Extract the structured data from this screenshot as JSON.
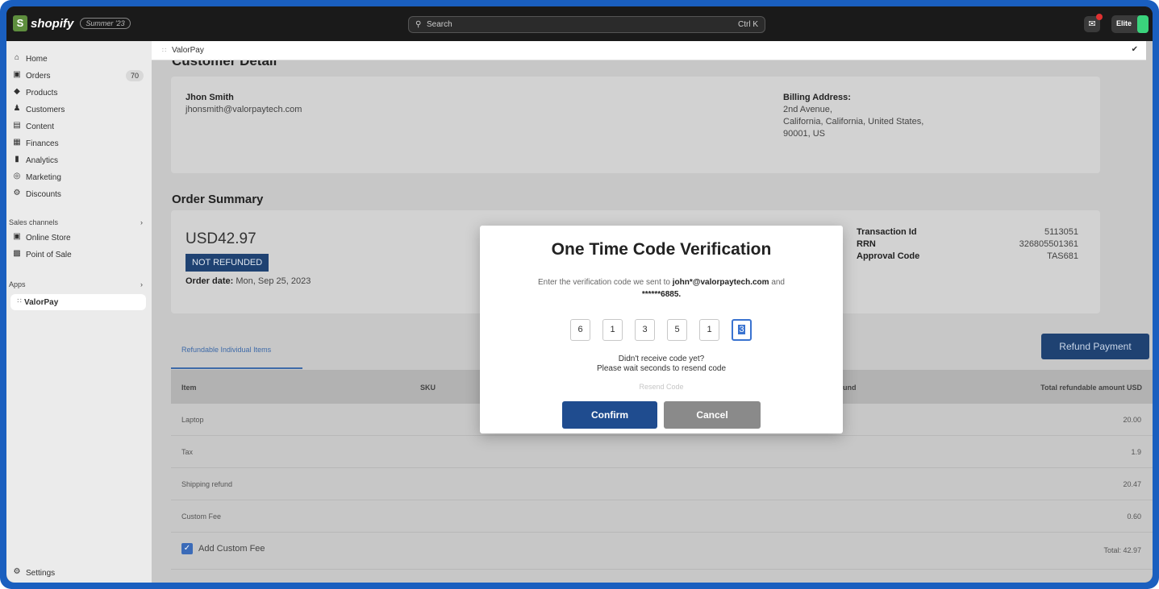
{
  "topbar": {
    "logo_glyph": "S",
    "brand": "shopify",
    "edition": "Summer '23",
    "search_placeholder": "Search",
    "search_shortcut": "Ctrl K",
    "store_name": "Elite"
  },
  "sidebar": {
    "items": [
      {
        "label": "Home",
        "icon": "home-icon"
      },
      {
        "label": "Orders",
        "icon": "orders-icon",
        "badge": "70"
      },
      {
        "label": "Products",
        "icon": "tag-icon"
      },
      {
        "label": "Customers",
        "icon": "person-icon"
      },
      {
        "label": "Content",
        "icon": "content-icon"
      },
      {
        "label": "Finances",
        "icon": "bank-icon"
      },
      {
        "label": "Analytics",
        "icon": "bar-chart-icon"
      },
      {
        "label": "Marketing",
        "icon": "target-icon"
      },
      {
        "label": "Discounts",
        "icon": "discount-icon"
      }
    ],
    "sales_channels_label": "Sales channels",
    "channels": [
      {
        "label": "Online Store",
        "icon": "store-icon"
      },
      {
        "label": "Point of Sale",
        "icon": "pos-icon"
      }
    ],
    "apps_label": "Apps",
    "apps": [
      {
        "label": "ValorPay",
        "icon": "grid-icon"
      }
    ],
    "settings_label": "Settings"
  },
  "app_header": {
    "title": "ValorPay"
  },
  "customer": {
    "section_title": "Customer Detail",
    "name": "Jhon Smith",
    "email": "jhonsmith@valorpaytech.com",
    "billing_label": "Billing Address:",
    "billing_line1": "2nd Avenue,",
    "billing_line2": "California, California, United States,",
    "billing_line3": "90001, US"
  },
  "order_summary": {
    "title": "Order Summary",
    "amount": "USD42.97",
    "status": "NOT REFUNDED",
    "order_date_label": "Order date:",
    "order_date": "Mon, Sep 25, 2023",
    "transaction_label": "Transaction Id",
    "transaction_value": "5113051",
    "rrn_label": "RRN",
    "rrn_value": "326805501361",
    "approval_label": "Approval Code",
    "approval_value": "TAS681"
  },
  "refund": {
    "tab_label": "Refundable Individual Items",
    "button_label": "Refund Payment",
    "columns": {
      "item": "Item",
      "sku": "SKU",
      "refund": "fund",
      "total": "Total refundable amount USD"
    },
    "rows": [
      {
        "item": "Laptop",
        "amount": "20.00"
      },
      {
        "item": "Tax",
        "amount": "1.9"
      },
      {
        "item": "Shipping refund",
        "amount": "20.47"
      },
      {
        "item": "Custom Fee",
        "amount": "0.60"
      }
    ],
    "add_fee_label": "Add Custom Fee",
    "total_text": "Total: 42.97"
  },
  "modal": {
    "title": "One Time Code Verification",
    "desc_prefix": "Enter the verification code we sent to",
    "email_masked": "john*@valorpaytech.com",
    "desc_and": "and",
    "phone_masked": "******6885.",
    "digits": [
      "6",
      "1",
      "3",
      "5",
      "1",
      "3"
    ],
    "info_line1": "Didn't receive code yet?",
    "info_line2": "Please wait seconds to resend code",
    "resend_label": "Resend Code",
    "confirm_label": "Confirm",
    "cancel_label": "Cancel"
  },
  "colors": {
    "frame": "#1a5fbf",
    "primary": "#1f4c8f",
    "badge_dark": "#1f4272"
  }
}
